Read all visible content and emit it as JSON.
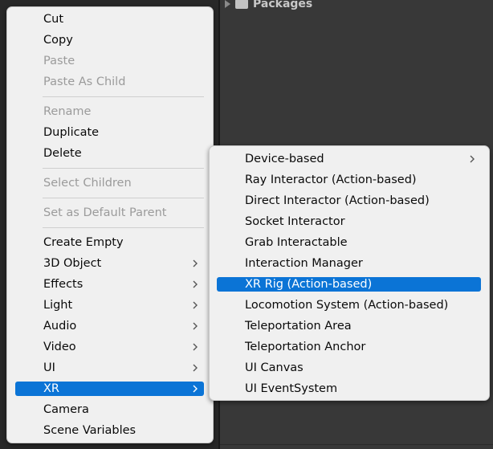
{
  "background": {
    "project_folder": "Packages"
  },
  "context_menu": {
    "items": [
      {
        "label": "Cut",
        "enabled": true
      },
      {
        "label": "Copy",
        "enabled": true
      },
      {
        "label": "Paste",
        "enabled": false
      },
      {
        "label": "Paste As Child",
        "enabled": false
      },
      {
        "label": "Rename",
        "enabled": false
      },
      {
        "label": "Duplicate",
        "enabled": true
      },
      {
        "label": "Delete",
        "enabled": true
      },
      {
        "label": "Select Children",
        "enabled": false
      },
      {
        "label": "Set as Default Parent",
        "enabled": false
      },
      {
        "label": "Create Empty",
        "enabled": true
      },
      {
        "label": "3D Object",
        "enabled": true,
        "submenu": true
      },
      {
        "label": "Effects",
        "enabled": true,
        "submenu": true
      },
      {
        "label": "Light",
        "enabled": true,
        "submenu": true
      },
      {
        "label": "Audio",
        "enabled": true,
        "submenu": true
      },
      {
        "label": "Video",
        "enabled": true,
        "submenu": true
      },
      {
        "label": "UI",
        "enabled": true,
        "submenu": true
      },
      {
        "label": "XR",
        "enabled": true,
        "submenu": true,
        "selected": true
      },
      {
        "label": "Camera",
        "enabled": true
      },
      {
        "label": "Scene Variables",
        "enabled": true
      }
    ]
  },
  "xr_submenu": {
    "items": [
      {
        "label": "Device-based",
        "submenu": true
      },
      {
        "label": "Ray Interactor (Action-based)"
      },
      {
        "label": "Direct Interactor (Action-based)"
      },
      {
        "label": "Socket Interactor"
      },
      {
        "label": "Grab Interactable"
      },
      {
        "label": "Interaction Manager"
      },
      {
        "label": "XR Rig (Action-based)",
        "selected": true
      },
      {
        "label": "Locomotion System (Action-based)"
      },
      {
        "label": "Teleportation Area"
      },
      {
        "label": "Teleportation Anchor"
      },
      {
        "label": "UI Canvas"
      },
      {
        "label": "UI EventSystem"
      }
    ]
  },
  "colors": {
    "menu_background": "#f0f0f0",
    "highlight": "#0b74d6",
    "disabled_text": "#9b9b9b",
    "editor_background": "#383838"
  }
}
